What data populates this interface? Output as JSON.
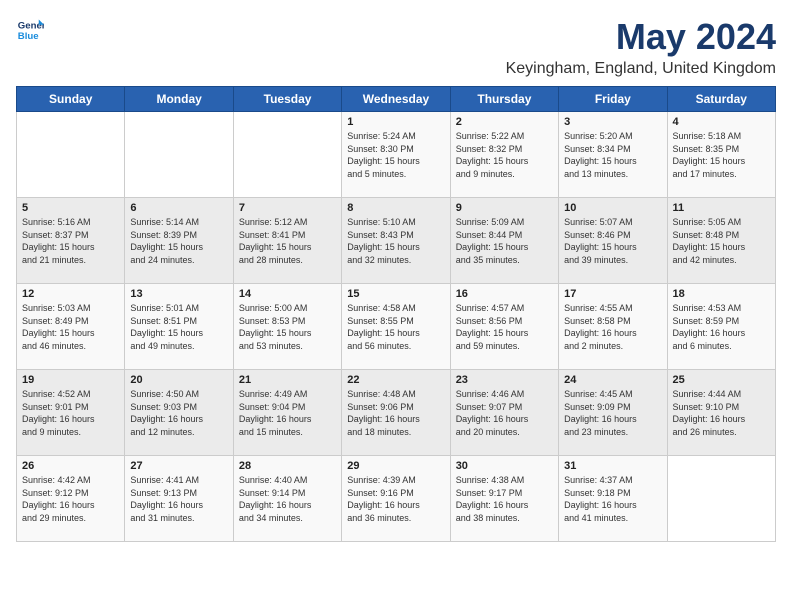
{
  "logo": {
    "line1": "General",
    "line2": "Blue"
  },
  "calendar": {
    "title": "May 2024",
    "subtitle": "Keyingham, England, United Kingdom",
    "days_of_week": [
      "Sunday",
      "Monday",
      "Tuesday",
      "Wednesday",
      "Thursday",
      "Friday",
      "Saturday"
    ],
    "weeks": [
      [
        {
          "day": "",
          "details": ""
        },
        {
          "day": "",
          "details": ""
        },
        {
          "day": "",
          "details": ""
        },
        {
          "day": "1",
          "details": "Sunrise: 5:24 AM\nSunset: 8:30 PM\nDaylight: 15 hours\nand 5 minutes."
        },
        {
          "day": "2",
          "details": "Sunrise: 5:22 AM\nSunset: 8:32 PM\nDaylight: 15 hours\nand 9 minutes."
        },
        {
          "day": "3",
          "details": "Sunrise: 5:20 AM\nSunset: 8:34 PM\nDaylight: 15 hours\nand 13 minutes."
        },
        {
          "day": "4",
          "details": "Sunrise: 5:18 AM\nSunset: 8:35 PM\nDaylight: 15 hours\nand 17 minutes."
        }
      ],
      [
        {
          "day": "5",
          "details": "Sunrise: 5:16 AM\nSunset: 8:37 PM\nDaylight: 15 hours\nand 21 minutes."
        },
        {
          "day": "6",
          "details": "Sunrise: 5:14 AM\nSunset: 8:39 PM\nDaylight: 15 hours\nand 24 minutes."
        },
        {
          "day": "7",
          "details": "Sunrise: 5:12 AM\nSunset: 8:41 PM\nDaylight: 15 hours\nand 28 minutes."
        },
        {
          "day": "8",
          "details": "Sunrise: 5:10 AM\nSunset: 8:43 PM\nDaylight: 15 hours\nand 32 minutes."
        },
        {
          "day": "9",
          "details": "Sunrise: 5:09 AM\nSunset: 8:44 PM\nDaylight: 15 hours\nand 35 minutes."
        },
        {
          "day": "10",
          "details": "Sunrise: 5:07 AM\nSunset: 8:46 PM\nDaylight: 15 hours\nand 39 minutes."
        },
        {
          "day": "11",
          "details": "Sunrise: 5:05 AM\nSunset: 8:48 PM\nDaylight: 15 hours\nand 42 minutes."
        }
      ],
      [
        {
          "day": "12",
          "details": "Sunrise: 5:03 AM\nSunset: 8:49 PM\nDaylight: 15 hours\nand 46 minutes."
        },
        {
          "day": "13",
          "details": "Sunrise: 5:01 AM\nSunset: 8:51 PM\nDaylight: 15 hours\nand 49 minutes."
        },
        {
          "day": "14",
          "details": "Sunrise: 5:00 AM\nSunset: 8:53 PM\nDaylight: 15 hours\nand 53 minutes."
        },
        {
          "day": "15",
          "details": "Sunrise: 4:58 AM\nSunset: 8:55 PM\nDaylight: 15 hours\nand 56 minutes."
        },
        {
          "day": "16",
          "details": "Sunrise: 4:57 AM\nSunset: 8:56 PM\nDaylight: 15 hours\nand 59 minutes."
        },
        {
          "day": "17",
          "details": "Sunrise: 4:55 AM\nSunset: 8:58 PM\nDaylight: 16 hours\nand 2 minutes."
        },
        {
          "day": "18",
          "details": "Sunrise: 4:53 AM\nSunset: 8:59 PM\nDaylight: 16 hours\nand 6 minutes."
        }
      ],
      [
        {
          "day": "19",
          "details": "Sunrise: 4:52 AM\nSunset: 9:01 PM\nDaylight: 16 hours\nand 9 minutes."
        },
        {
          "day": "20",
          "details": "Sunrise: 4:50 AM\nSunset: 9:03 PM\nDaylight: 16 hours\nand 12 minutes."
        },
        {
          "day": "21",
          "details": "Sunrise: 4:49 AM\nSunset: 9:04 PM\nDaylight: 16 hours\nand 15 minutes."
        },
        {
          "day": "22",
          "details": "Sunrise: 4:48 AM\nSunset: 9:06 PM\nDaylight: 16 hours\nand 18 minutes."
        },
        {
          "day": "23",
          "details": "Sunrise: 4:46 AM\nSunset: 9:07 PM\nDaylight: 16 hours\nand 20 minutes."
        },
        {
          "day": "24",
          "details": "Sunrise: 4:45 AM\nSunset: 9:09 PM\nDaylight: 16 hours\nand 23 minutes."
        },
        {
          "day": "25",
          "details": "Sunrise: 4:44 AM\nSunset: 9:10 PM\nDaylight: 16 hours\nand 26 minutes."
        }
      ],
      [
        {
          "day": "26",
          "details": "Sunrise: 4:42 AM\nSunset: 9:12 PM\nDaylight: 16 hours\nand 29 minutes."
        },
        {
          "day": "27",
          "details": "Sunrise: 4:41 AM\nSunset: 9:13 PM\nDaylight: 16 hours\nand 31 minutes."
        },
        {
          "day": "28",
          "details": "Sunrise: 4:40 AM\nSunset: 9:14 PM\nDaylight: 16 hours\nand 34 minutes."
        },
        {
          "day": "29",
          "details": "Sunrise: 4:39 AM\nSunset: 9:16 PM\nDaylight: 16 hours\nand 36 minutes."
        },
        {
          "day": "30",
          "details": "Sunrise: 4:38 AM\nSunset: 9:17 PM\nDaylight: 16 hours\nand 38 minutes."
        },
        {
          "day": "31",
          "details": "Sunrise: 4:37 AM\nSunset: 9:18 PM\nDaylight: 16 hours\nand 41 minutes."
        },
        {
          "day": "",
          "details": ""
        }
      ]
    ]
  }
}
